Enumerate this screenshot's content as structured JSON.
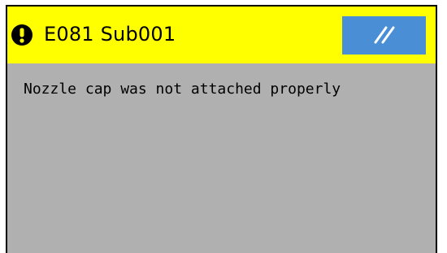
{
  "header": {
    "alert_icon": "exclamation-circle-icon",
    "title": "E081 Sub001",
    "menu_button_icon": "double-slash-icon",
    "background_color": "#ffff00",
    "button_color": "#4a8fd6"
  },
  "body": {
    "message": "Nozzle cap was not attached properly",
    "background_color": "#b0b0b0"
  }
}
